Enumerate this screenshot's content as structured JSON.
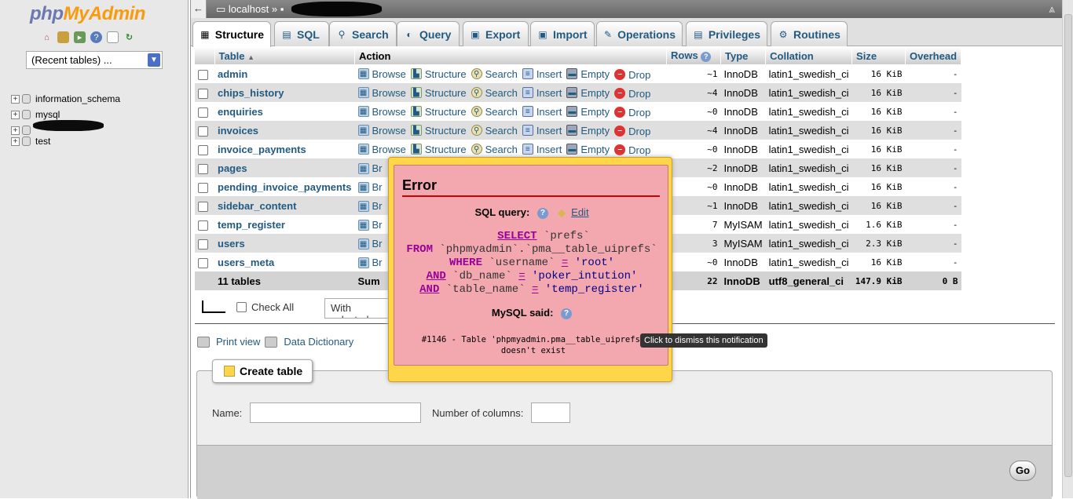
{
  "app": {
    "logo_php": "php",
    "logo_myadmin": "MyAdmin"
  },
  "sidebar": {
    "recent_tables": "(Recent tables) ...",
    "databases": [
      "information_schema",
      "mysql",
      "",
      "test"
    ]
  },
  "topbar": {
    "server": "localhost",
    "separator": "»"
  },
  "tabs": [
    {
      "label": "Structure",
      "icon": "structure-icon",
      "active": true
    },
    {
      "label": "SQL",
      "icon": "sql-icon"
    },
    {
      "label": "Search",
      "icon": "search-icon"
    },
    {
      "label": "Query",
      "icon": "query-icon"
    },
    {
      "label": "Export",
      "icon": "export-icon"
    },
    {
      "label": "Import",
      "icon": "import-icon"
    },
    {
      "label": "Operations",
      "icon": "wrench-icon"
    },
    {
      "label": "Privileges",
      "icon": "privileges-icon"
    },
    {
      "label": "Routines",
      "icon": "routines-icon"
    }
  ],
  "table": {
    "headers": {
      "table": "Table",
      "action": "Action",
      "rows": "Rows",
      "type": "Type",
      "collation": "Collation",
      "size": "Size",
      "overhead": "Overhead"
    },
    "actions": [
      "Browse",
      "Structure",
      "Search",
      "Insert",
      "Empty",
      "Drop"
    ],
    "rows": [
      {
        "name": "admin",
        "rows": "~1",
        "type": "InnoDB",
        "collation": "latin1_swedish_ci",
        "size": "16 KiB",
        "overhead": "-"
      },
      {
        "name": "chips_history",
        "rows": "~4",
        "type": "InnoDB",
        "collation": "latin1_swedish_ci",
        "size": "16 KiB",
        "overhead": "-"
      },
      {
        "name": "enquiries",
        "rows": "~0",
        "type": "InnoDB",
        "collation": "latin1_swedish_ci",
        "size": "16 KiB",
        "overhead": "-"
      },
      {
        "name": "invoices",
        "rows": "~4",
        "type": "InnoDB",
        "collation": "latin1_swedish_ci",
        "size": "16 KiB",
        "overhead": "-"
      },
      {
        "name": "invoice_payments",
        "rows": "~0",
        "type": "InnoDB",
        "collation": "latin1_swedish_ci",
        "size": "16 KiB",
        "overhead": "-"
      },
      {
        "name": "pages",
        "rows": "~2",
        "type": "InnoDB",
        "collation": "latin1_swedish_ci",
        "size": "16 KiB",
        "overhead": "-"
      },
      {
        "name": "pending_invoice_payments",
        "rows": "~0",
        "type": "InnoDB",
        "collation": "latin1_swedish_ci",
        "size": "16 KiB",
        "overhead": "-"
      },
      {
        "name": "sidebar_content",
        "rows": "~1",
        "type": "InnoDB",
        "collation": "latin1_swedish_ci",
        "size": "16 KiB",
        "overhead": "-"
      },
      {
        "name": "temp_register",
        "rows": "7",
        "type": "MyISAM",
        "collation": "latin1_swedish_ci",
        "size": "1.6 KiB",
        "overhead": "-"
      },
      {
        "name": "users",
        "rows": "3",
        "type": "MyISAM",
        "collation": "latin1_swedish_ci",
        "size": "2.3 KiB",
        "overhead": "-"
      },
      {
        "name": "users_meta",
        "rows": "~0",
        "type": "InnoDB",
        "collation": "latin1_swedish_ci",
        "size": "16 KiB",
        "overhead": "-"
      }
    ],
    "footer": {
      "tables": "11 tables",
      "sum": "Sum",
      "rows": "22",
      "type": "InnoDB",
      "collation": "utf8_general_ci",
      "size": "147.9 KiB",
      "overhead": "0 B"
    },
    "abbrev_action": "Br"
  },
  "controls": {
    "check_all": "Check All",
    "with_selected": "With selected:",
    "print_view": "Print view",
    "data_dictionary": "Data Dictionary"
  },
  "create": {
    "legend": "Create table",
    "name_label": "Name:",
    "cols_label": "Number of columns:",
    "go": "Go"
  },
  "error": {
    "title": "Error",
    "sql_query_label": "SQL query:",
    "edit": "Edit",
    "sql": {
      "l1_kw": "SELECT",
      "l1_rest": " `prefs`",
      "l2_kw": "FROM",
      "l2_rest": " `phpmyadmin`.`pma__table_uiprefs`",
      "l3_kw": "WHERE",
      "l3_col": " `username` ",
      "l3_op": "=",
      "l3_val": " 'root'",
      "l4_kw": "AND",
      "l4_col": " `db_name` ",
      "l4_op": "=",
      "l4_val": " 'poker_intution'",
      "l5_kw": "AND",
      "l5_col": " `table_name` ",
      "l5_op": "=",
      "l5_val": " 'temp_register'"
    },
    "mysql_said": "MySQL said:",
    "message": "#1146 - Table 'phpmyadmin.pma__table_uiprefs'\ndoesn't exist"
  },
  "tooltip": "Click to dismiss this notification"
}
